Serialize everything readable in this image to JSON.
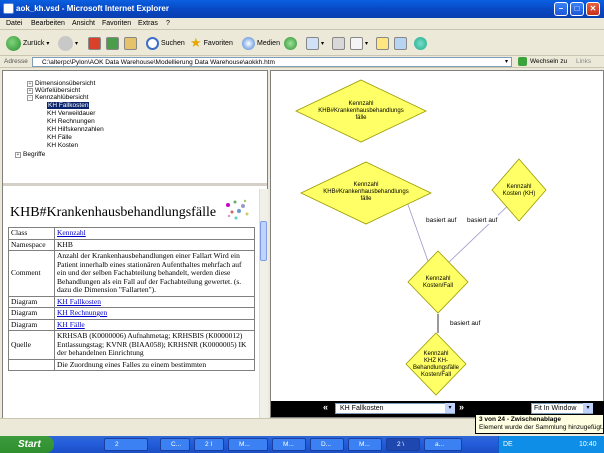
{
  "window": {
    "title": "aok_kh.vsd - Microsoft Internet Explorer"
  },
  "menu": [
    "Datei",
    "Bearbeiten",
    "Ansicht",
    "Favoriten",
    "Extras",
    "?"
  ],
  "toolbar": {
    "back": "Zurück",
    "search": "Suchen",
    "favorites": "Favoriten",
    "media": "Medien"
  },
  "address": {
    "label": "Adresse",
    "value": "C:\\alterpc\\Pylon\\AOK Data Warehouse\\Modellierung Data Warehouse\\aokkh.htm",
    "go": "Wechseln zu",
    "links": "Links"
  },
  "tree": {
    "items": [
      {
        "label": "Dimensionsübersicht",
        "box": "+"
      },
      {
        "label": "Würfelübersicht",
        "box": "+"
      },
      {
        "label": "Kennzahlübersicht",
        "box": "-"
      },
      {
        "label": "KH Fallkosten"
      },
      {
        "label": "KH Verweildauer"
      },
      {
        "label": "KH Rechnungen"
      },
      {
        "label": "KH Hilfskennzahlen"
      },
      {
        "label": "KH Fälle"
      },
      {
        "label": "KH Kosten"
      },
      {
        "label": "Begriffe",
        "box": "+"
      }
    ]
  },
  "doc": {
    "title": "KHB#Krankenhausbehandlungsfälle",
    "rows": [
      {
        "key": "Class",
        "value": "Kennzahl",
        "link": true
      },
      {
        "key": "Namespace",
        "value": "KHB",
        "link": false
      },
      {
        "key": "Comment",
        "value": "Anzahl der Krankenhausbehandlungen einer Fallart Wird ein Patient innerhalb eines stationären Aufenthaltes mehrfach auf ein und der selben Fachabteilung behandelt, werden diese Behandlungen als ein Fall auf der Fachabteilung gewertet. (s. dazu die Dimension \"Fallarten\").",
        "link": false
      },
      {
        "key": "Diagram",
        "value": "KH Fallkosten",
        "link": true
      },
      {
        "key": "Diagram",
        "value": "KH Rechnungen",
        "link": true
      },
      {
        "key": "Diagram",
        "value": "KH Fälle",
        "link": true
      },
      {
        "key": "Quelle",
        "value": "KRHSAB (K0000006) Aufnahmetag; KRHSBIS (K0000012) Entlassungstag; KVNR (BIAA058); KRHSNR (K0000005) IK der behandelnen Einrichtung",
        "link": false
      },
      {
        "key": "",
        "value": "Die Zuordnung eines Falles zu einem bestimmten",
        "link": false
      }
    ]
  },
  "diagram": {
    "nodes": [
      {
        "label": [
          "Kennzahl",
          "KHB#Krankenhausbehandlungs",
          "fälle"
        ]
      },
      {
        "label": [
          "Kennzahl",
          "KHB#Krankenhausbehandlungs",
          "fälle"
        ]
      },
      {
        "label": [
          "Kennzahl",
          "Kosten (KH)"
        ]
      },
      {
        "label": [
          "Kennzahl",
          "Kosten/Fall"
        ]
      },
      {
        "label": [
          "Kennzahl",
          "KHZ KH-",
          "Behandlungsfälle",
          "Kosten/Fall"
        ]
      }
    ],
    "edge_label": "basiert auf",
    "page_select": "KH Fallkosten",
    "fit_select": "Fit In Window",
    "nav_prev": "«",
    "nav_next": "»"
  },
  "clipboard": {
    "title": "3 von 24 - Zwischenablage",
    "text": "Element wurde der Sammlung hinzugefügt."
  },
  "taskbar": {
    "start": "Start",
    "tasks": [
      "2",
      "C...",
      "2 I",
      "M...",
      "M...",
      "D...",
      "M...",
      "2 \\",
      "a..."
    ],
    "lang": "DE",
    "time": "10:40"
  },
  "colors": {
    "node_fill": "#ffff66",
    "node_stroke": "#9a9a00",
    "selection": "#0a246a",
    "titlebar": "#0a5fe0"
  }
}
